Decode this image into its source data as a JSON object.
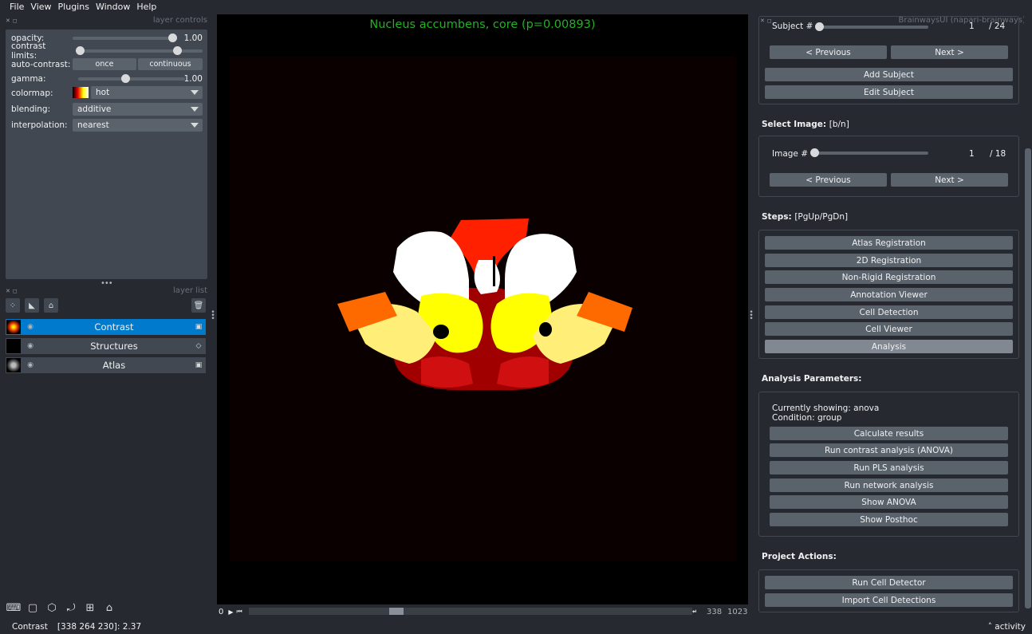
{
  "menu": [
    "File",
    "View",
    "Plugins",
    "Window",
    "Help"
  ],
  "layer_controls": {
    "title": "layer controls",
    "opacity": {
      "label": "opacity:",
      "value": "1.00"
    },
    "contrast_limits": {
      "label": "contrast limits:"
    },
    "auto_contrast": {
      "label": "auto-contrast:",
      "once": "once",
      "continuous": "continuous"
    },
    "gamma": {
      "label": "gamma:",
      "value": "1.00"
    },
    "colormap": {
      "label": "colormap:",
      "value": "hot"
    },
    "blending": {
      "label": "blending:",
      "value": "additive"
    },
    "interpolation": {
      "label": "interpolation:",
      "value": "nearest"
    }
  },
  "layer_list": {
    "title": "layer list",
    "layers": [
      {
        "name": "Contrast",
        "selected": true
      },
      {
        "name": "Structures",
        "selected": false
      },
      {
        "name": "Atlas",
        "selected": false
      }
    ]
  },
  "canvas": {
    "title": "Nucleus accumbens, core (p=0.00893)",
    "title_color": "#22b222"
  },
  "dims": {
    "left_value": "0",
    "current": "338",
    "max": "1023"
  },
  "right_panel": {
    "window_title": "BrainwaysUI (napari-brainways)",
    "subject": {
      "label": "Subject #",
      "current": "1",
      "total": "/ 24"
    },
    "subject_prev": "< Previous",
    "subject_next": "Next >",
    "add_subject": "Add Subject",
    "edit_subject": "Edit Subject",
    "select_image": {
      "title": "Select Image:",
      "shortcut": "[b/n]"
    },
    "image": {
      "label": "Image #",
      "current": "1",
      "total": "/ 18"
    },
    "image_prev": "< Previous",
    "image_next": "Next >",
    "steps": {
      "title": "Steps:",
      "shortcut": "[PgUp/PgDn]"
    },
    "step_buttons": [
      "Atlas Registration",
      "2D Registration",
      "Non-Rigid Registration",
      "Annotation Viewer",
      "Cell Detection",
      "Cell Viewer",
      "Analysis"
    ],
    "analysis": {
      "title": "Analysis Parameters:",
      "showing": "Currently showing: anova",
      "condition": "Condition: group",
      "buttons": [
        "Calculate results",
        "Run contrast analysis (ANOVA)",
        "Run PLS analysis",
        "Run network analysis",
        "Show ANOVA",
        "Show Posthoc"
      ]
    },
    "project": {
      "title": "Project Actions:",
      "buttons": [
        "Run Cell Detector",
        "Import Cell Detections"
      ]
    }
  },
  "status": {
    "layer": "Contrast",
    "coords": "[338 264 230]: 2.37",
    "activity": "activity"
  }
}
